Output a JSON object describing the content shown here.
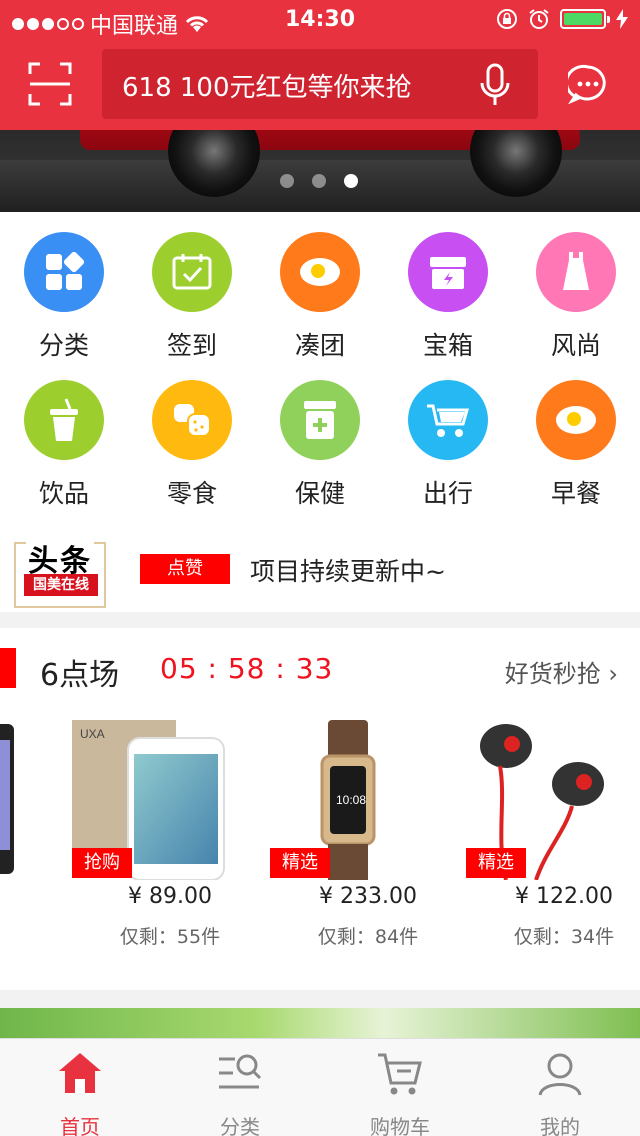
{
  "status_bar": {
    "carrier": "中国联通",
    "time": "14:30"
  },
  "search": {
    "placeholder": "618 100元红包等你来抢"
  },
  "banner": {
    "slide_count": 3,
    "active_slide": 3
  },
  "categories": [
    {
      "label": "分类",
      "icon": "category-icon",
      "color": "#3a8ff5"
    },
    {
      "label": "签到",
      "icon": "calendar-check-icon",
      "color": "#9ccf2e"
    },
    {
      "label": "凑团",
      "icon": "fried-egg-icon",
      "color": "#ff7a1a"
    },
    {
      "label": "宝箱",
      "icon": "treasure-box-icon",
      "color": "#c84ff2"
    },
    {
      "label": "风尚",
      "icon": "dress-icon",
      "color": "#ff78b5"
    },
    {
      "label": "饮品",
      "icon": "drink-cup-icon",
      "color": "#9ccf2e"
    },
    {
      "label": "零食",
      "icon": "cookie-icon",
      "color": "#ffb90f"
    },
    {
      "label": "保健",
      "icon": "health-box-icon",
      "color": "#8fd15a"
    },
    {
      "label": "出行",
      "icon": "stroller-icon",
      "color": "#26b8f2"
    },
    {
      "label": "早餐",
      "icon": "fried-egg-icon",
      "color": "#ff7a1a"
    }
  ],
  "headline": {
    "logo_top": "头条",
    "logo_bottom": "国美在线",
    "tag": "点赞",
    "text": "项目持续更新中~"
  },
  "flash_sale": {
    "title": "6点场",
    "countdown": "05 : 58 : 33",
    "more": "好货秒抢 ›",
    "products": [
      {
        "tag": "抢购",
        "price": "¥ 89.00",
        "stock": "仅剩：55件",
        "image": "screen-protector"
      },
      {
        "tag": "精选",
        "price": "¥ 233.00",
        "stock": "仅剩：84件",
        "image": "smart-band"
      },
      {
        "tag": "精选",
        "price": "¥ 122.00",
        "stock": "仅剩：34件",
        "image": "earphones"
      }
    ]
  },
  "tabbar": [
    {
      "label": "首页",
      "icon": "home-icon",
      "active": true
    },
    {
      "label": "分类",
      "icon": "category-search-icon",
      "active": false
    },
    {
      "label": "购物车",
      "icon": "cart-icon",
      "active": false
    },
    {
      "label": "我的",
      "icon": "user-icon",
      "active": false
    }
  ],
  "colors": {
    "brand_red": "#e8323f",
    "accent_red": "#f0121f"
  }
}
